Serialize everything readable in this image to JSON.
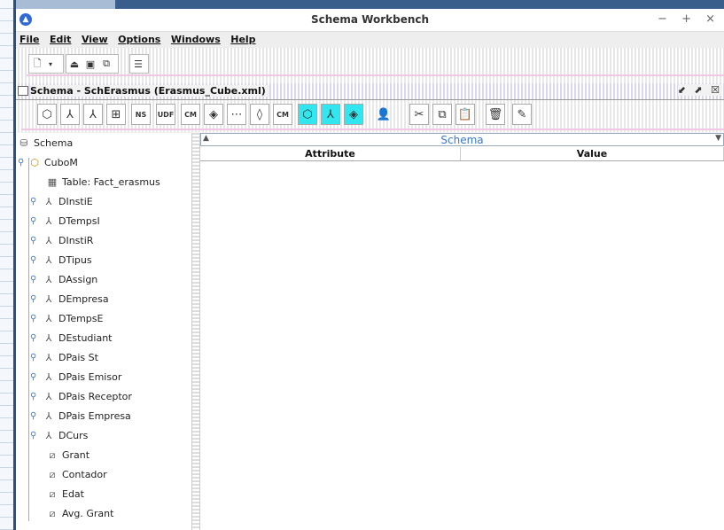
{
  "window": {
    "title": "Schema Workbench",
    "controls": "− + ×"
  },
  "menu": [
    "File",
    "Edit",
    "View",
    "Options",
    "Windows",
    "Help"
  ],
  "internal_frame": {
    "title": "Schema - SchErasmus (Erasmus_Cube.xml)",
    "controls": "⬋ ⬈ ☒"
  },
  "toolbar_small": [
    "NS",
    "UDF",
    "CM"
  ],
  "panel": {
    "header": "Schema",
    "columns": [
      "Attribute",
      "Value"
    ]
  },
  "tree": {
    "root": "Schema",
    "cube": "CuboM",
    "table": "Table: Fact_erasmus",
    "dimensions": [
      "DInstiE",
      "DTempsI",
      "DInstiR",
      "DTipus",
      "DAssign",
      "DEmpresa",
      "DTempsE",
      "DEstudiant",
      "DPais St",
      "DPais Emisor",
      "DPais Receptor",
      "DPais Empresa",
      "DCurs"
    ],
    "measures": [
      "Grant",
      "Contador",
      "Edat",
      "Avg. Grant"
    ]
  },
  "colors": {
    "accent": "#32e6f0",
    "link_blue": "#3a78c8"
  }
}
